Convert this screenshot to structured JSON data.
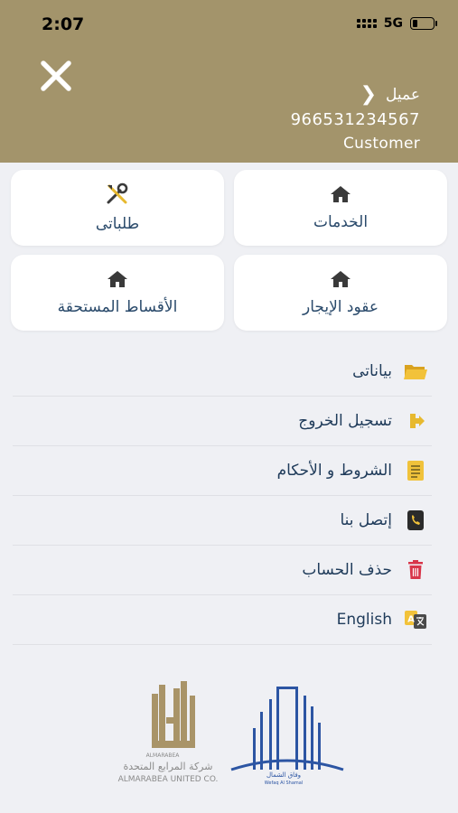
{
  "status": {
    "time": "2:07",
    "network": "5G"
  },
  "header": {
    "user_name": "عميل",
    "phone": "966531234567",
    "role": "Customer"
  },
  "cards": {
    "services": "الخدمات",
    "my_requests": "طلباتى",
    "lease_contracts": "عقود الإيجار",
    "due_installments": "الأقساط المستحقة"
  },
  "menu": {
    "my_data": "بياناتى",
    "logout": "تسجيل الخروج",
    "terms": "الشروط و الأحكام",
    "contact": "إتصل بنا",
    "delete_account": "حذف الحساب",
    "language": "English"
  },
  "logos": {
    "almarabea_small": "ALMARABEA",
    "almarabea_ar": "شركة المرابع المتحدة",
    "almarabea_en": "ALMARABEA UNITED CO.",
    "wefaq_ar": "وفاق الشمال",
    "wefaq_en": "Wefaq Al Shamal"
  },
  "colors": {
    "header_bg": "#a3946b",
    "page_bg": "#eff0f4",
    "card_text": "#2a4a6b",
    "menu_text": "#1f3b5a",
    "icon_gold": "#e7b92f",
    "delete_red": "#d8364a",
    "logo_blue": "#2c55a3",
    "logo_gold": "#a99468"
  }
}
